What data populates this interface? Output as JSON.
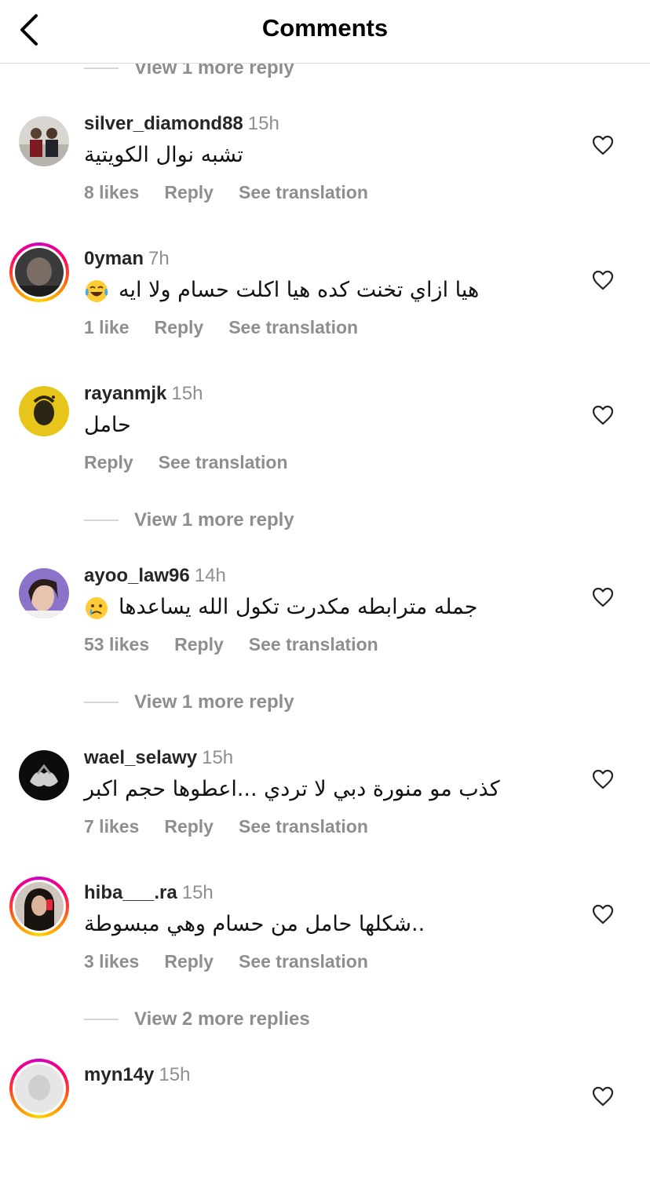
{
  "header": {
    "title": "Comments"
  },
  "view_more": [
    "View 1 more reply",
    "View 1 more reply",
    "View 1 more reply",
    "View 2 more replies"
  ],
  "comments": [
    {
      "username": "silver_diamond88",
      "time": "15h",
      "text": "تشبه نوال الكويتية",
      "likes": "8 likes",
      "reply": "Reply",
      "translate": "See translation"
    },
    {
      "username": "0yman",
      "time": "7h",
      "text": "هيا ازاي تخنت كده هيا  اكلت حسام ولا ايه",
      "likes": "1 like",
      "reply": "Reply",
      "translate": "See translation"
    },
    {
      "username": "rayanmjk",
      "time": "15h",
      "text": "حامل",
      "likes": "",
      "reply": "Reply",
      "translate": "See translation"
    },
    {
      "username": "ayoo_law96",
      "time": "14h",
      "text": "جمله مترابطه مكدرت تكول الله يساعدها",
      "likes": "53 likes",
      "reply": "Reply",
      "translate": "See translation"
    },
    {
      "username": "wael_selawy",
      "time": "15h",
      "text": "كذب مو منورة دبي لا تردي ...اعطوها حجم اكبر",
      "likes": "7 likes",
      "reply": "Reply",
      "translate": "See translation"
    },
    {
      "username": "hiba___.ra",
      "time": "15h",
      "text": "شكلها حامل من حسام وهي مبسوطة..",
      "likes": "3 likes",
      "reply": "Reply",
      "translate": "See translation"
    },
    {
      "username": "myn14y",
      "time": "15h",
      "text": "",
      "likes": "",
      "reply": "",
      "translate": ""
    }
  ],
  "icons": {
    "back": "chevron-left-icon",
    "like": "heart-outline-icon",
    "emoji_laugh": "tears-of-joy-emoji",
    "emoji_cry": "crying-face-emoji"
  },
  "colors": {
    "muted": "#8e8e8e",
    "story_ring": "#ff0069"
  }
}
